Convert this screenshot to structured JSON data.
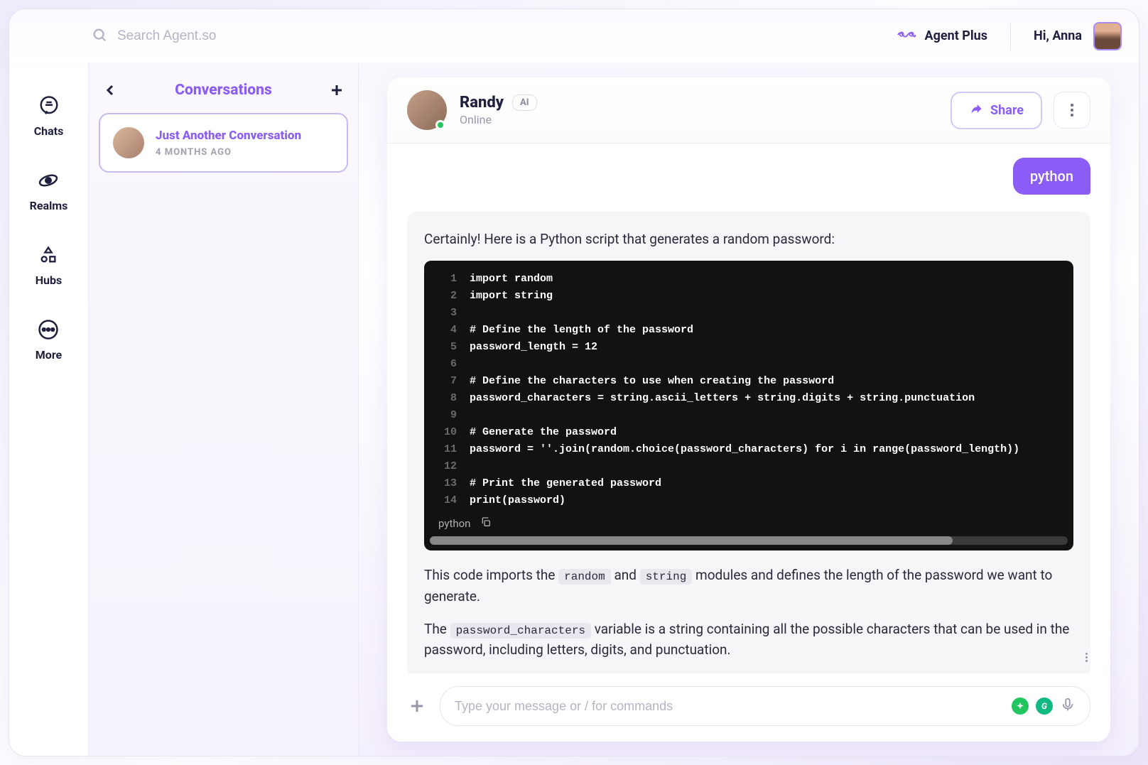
{
  "search": {
    "placeholder": "Search Agent.so"
  },
  "top": {
    "agent_plus": "Agent Plus",
    "greeting": "Hi, Anna"
  },
  "nav": {
    "chats": "Chats",
    "realms": "Realms",
    "hubs": "Hubs",
    "more": "More"
  },
  "conversations": {
    "title": "Conversations",
    "item": {
      "name": "Just Another Conversation",
      "time": "4 MONTHS AGO"
    }
  },
  "chat": {
    "agent_name": "Randy",
    "ai_badge": "AI",
    "status": "Online",
    "share": "Share"
  },
  "messages": {
    "user1": "python",
    "ai_intro": "Certainly! Here is a Python script that generates a random password:",
    "code": {
      "lang": "python",
      "lines": [
        "import random",
        "import string",
        "",
        "# Define the length of the password",
        "password_length = 12",
        "",
        "# Define the characters to use when creating the password",
        "password_characters = string.ascii_letters + string.digits + string.punctuation",
        "",
        "# Generate the password",
        "password = ''.join(random.choice(password_characters) for i in range(password_length))",
        "",
        "# Print the generated password",
        "print(password)"
      ]
    },
    "explain_p1_a": "This code imports the ",
    "explain_p1_code1": "random",
    "explain_p1_b": " and ",
    "explain_p1_code2": "string",
    "explain_p1_c": " modules and defines the length of the password we want to generate.",
    "explain_p2_a": "The ",
    "explain_p2_code1": "password_characters",
    "explain_p2_b": " variable is a string containing all the possible characters that can be used in the password, including letters, digits, and punctuation."
  },
  "input": {
    "placeholder": "Type your message or / for commands"
  }
}
